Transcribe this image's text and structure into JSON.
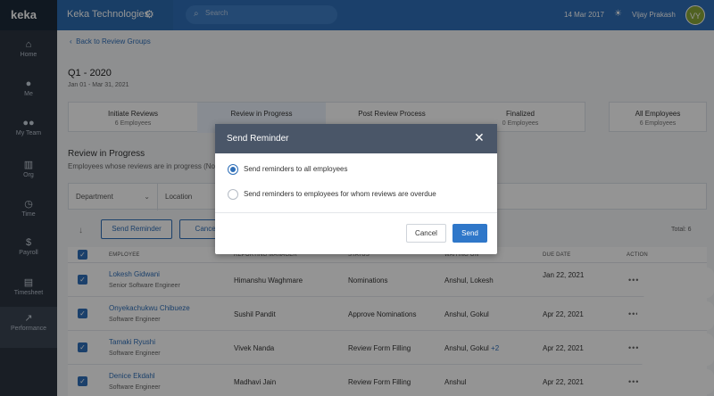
{
  "topbar": {
    "logo": "keka",
    "company": "Keka Technologies",
    "search_placeholder": "Search",
    "date": "14 Mar 2017",
    "user_name": "Vijay Prakash",
    "avatar_initials": "VY"
  },
  "sidebar": {
    "items": [
      {
        "label": "Home",
        "icon": "home-icon"
      },
      {
        "label": "Me",
        "icon": "person-icon"
      },
      {
        "label": "My Team",
        "icon": "team-icon"
      },
      {
        "label": "Org",
        "icon": "building-icon"
      },
      {
        "label": "Time",
        "icon": "clock-icon"
      },
      {
        "label": "Payroll",
        "icon": "dollar-icon"
      },
      {
        "label": "Timesheet",
        "icon": "timesheet-icon"
      },
      {
        "label": "Performance",
        "icon": "chart-icon"
      }
    ]
  },
  "breadcrumb": "Back to Review Groups",
  "page": {
    "title": "Q1 - 2020",
    "subtitle": "Jan 01 - Mar 31, 2021"
  },
  "stages": [
    {
      "label": "Initiate Reviews",
      "count": "6 Employees"
    },
    {
      "label": "Review in Progress",
      "count": ""
    },
    {
      "label": "Post Review Process",
      "count": ""
    },
    {
      "label": "Finalized",
      "count": "0 Employees"
    }
  ],
  "all_employees": {
    "label": "All Employees",
    "count": "6 Employees"
  },
  "section": {
    "title": "Review in Progress",
    "subtitle": "Employees whose reviews are in progress (No"
  },
  "filters": {
    "department": "Department",
    "location": "Location"
  },
  "toolbar": {
    "send_reminder": "Send Reminder",
    "cancel": "Cancel",
    "total": "Total: 6"
  },
  "table": {
    "headers": {
      "employee": "Employee",
      "manager": "Reporting Manager",
      "status": "Status",
      "waiting": "Waiting On",
      "due": "Due Date",
      "action": "Action"
    },
    "rows": [
      {
        "name": "Lokesh Gidwani",
        "role": "Senior Software Engineer",
        "manager": "Himanshu Waghmare",
        "status": "Nominations",
        "waiting": "Anshul, Lokesh",
        "extra": "",
        "due": "Jan 22, 2021"
      },
      {
        "name": "Onyekachukwu Chibueze",
        "role": "Software Engineer",
        "manager": "Sushil Pandit",
        "status": "Approve Nominations",
        "waiting": "Anshul, Gokul",
        "extra": "",
        "due": "Apr 22, 2021"
      },
      {
        "name": "Tamaki Ryushi",
        "role": "Software Engineer",
        "manager": "Vivek Nanda",
        "status": "Review Form Filling",
        "waiting": "Anshul, Gokul",
        "extra": "+2",
        "due": "Apr 22, 2021"
      },
      {
        "name": "Denice Ekdahl",
        "role": "Software Engineer",
        "manager": "Madhavi Jain",
        "status": "Review Form Filling",
        "waiting": "Anshul",
        "extra": "",
        "due": "Apr 22, 2021"
      }
    ]
  },
  "modal": {
    "title": "Send Reminder",
    "option_all": "Send reminders to all employees",
    "option_overdue": "Send reminders to employees for whom reviews are overdue",
    "cancel": "Cancel",
    "send": "Send"
  },
  "colors": {
    "primary": "#2f6fb8",
    "topbar": "#2f6fb8",
    "sidebar": "#2c3440",
    "modal_header": "#4a5668"
  }
}
